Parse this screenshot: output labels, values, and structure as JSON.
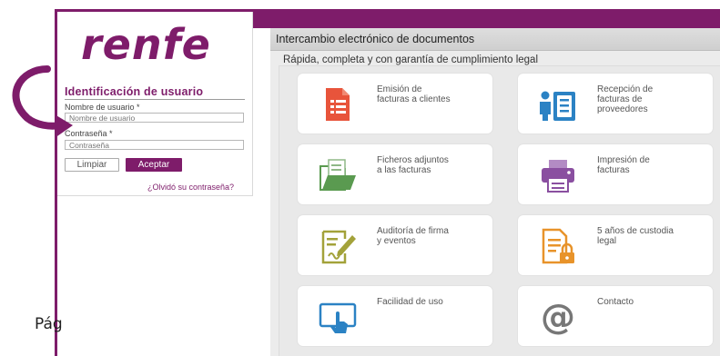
{
  "brand": {
    "logo_text": "renfe",
    "color": "#7e1c6a"
  },
  "login": {
    "title": "Identificación de usuario",
    "username_label": "Nombre de usuario *",
    "username_placeholder": "Nombre de usuario",
    "password_label": "Contraseña *",
    "password_placeholder": "Contraseña",
    "clear_label": "Limpiar",
    "accept_label": "Aceptar",
    "forgot_label": "¿Olvidó su contraseña?"
  },
  "page_fragment": "Pág",
  "main": {
    "title": "Intercambio electrónico de documentos",
    "tab_label": "Rápida, completa y con garantía de cumplimiento legal",
    "tiles": [
      {
        "label": "Emisión de\nfacturas a clientes",
        "icon": "invoice-document-icon",
        "color": "#e8543b"
      },
      {
        "label": "Recepción de\nfacturas de\nproveedores",
        "icon": "person-document-icon",
        "color": "#2b82c4"
      },
      {
        "label": "Ficheros adjuntos\na las facturas",
        "icon": "folder-files-icon",
        "color": "#5a9a50"
      },
      {
        "label": "Impresión de\nfacturas",
        "icon": "printer-icon",
        "color": "#8a4fa0"
      },
      {
        "label": "Auditoría de firma\ny eventos",
        "icon": "signature-edit-icon",
        "color": "#a3a23a"
      },
      {
        "label": "5 años de custodia\nlegal",
        "icon": "locked-document-icon",
        "color": "#e8932a"
      },
      {
        "label": "Facilidad de uso",
        "icon": "touch-screen-icon",
        "color": "#2b82c4"
      },
      {
        "label": "Contacto",
        "icon": "at-sign-icon",
        "color": "#777777"
      }
    ]
  }
}
